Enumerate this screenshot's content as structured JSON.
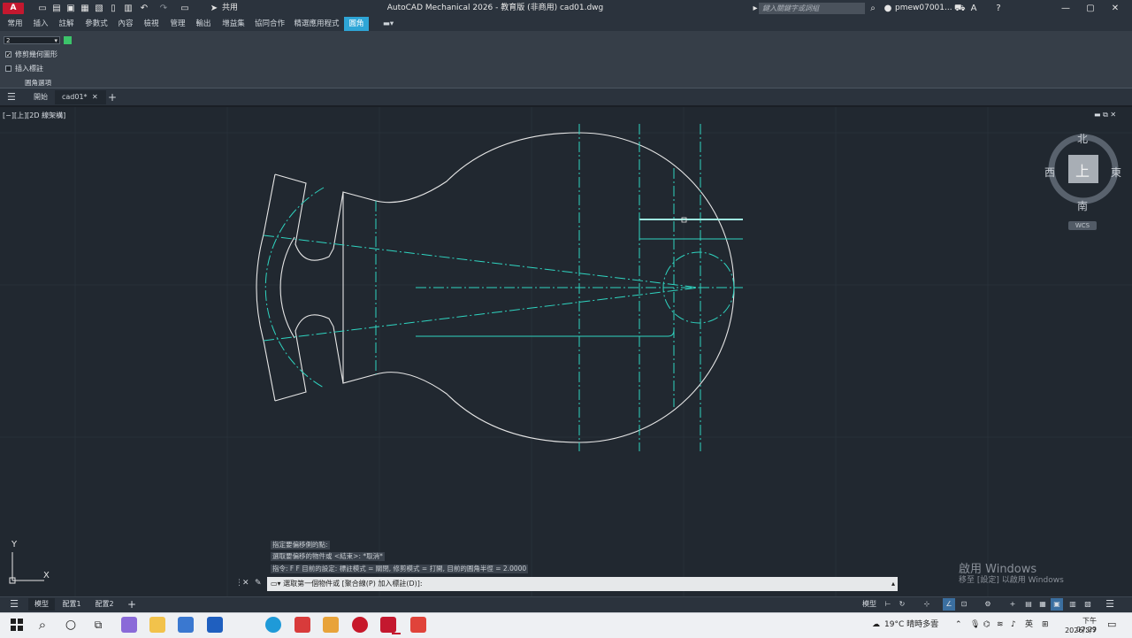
{
  "titlebar": {
    "app_icon": "A",
    "app_icon_sub": "MEC",
    "share_label": "共用",
    "title": "AutoCAD Mechanical 2026 - 教育版 (非商用)    cad01.dwg",
    "search_placeholder": "鍵入關鍵字或詞組",
    "user": "pmew07001...",
    "icons": [
      "new-icon",
      "open-icon",
      "save-icon",
      "saveas-icon",
      "print-icon",
      "undo-icon",
      "redo-icon",
      "share-icon",
      "search-icon",
      "user-icon",
      "cart-icon",
      "help-icon",
      "minimize-icon",
      "maximize-icon",
      "close-icon"
    ]
  },
  "ribbon": {
    "tabs": [
      "常用",
      "插入",
      "註解",
      "參數式",
      "內容",
      "檢視",
      "管理",
      "輸出",
      "增益集",
      "協同合作",
      "精選應用程式",
      "圓角"
    ],
    "active_tab": "圓角",
    "combo_value": "2",
    "checkbox1_label": "修剪幾何圖形",
    "checkbox1_checked": true,
    "checkbox2_label": "插入標註",
    "checkbox2_checked": false,
    "panel_title": "圓角選項"
  },
  "filetabs": {
    "start": "開始",
    "doc": "cad01*"
  },
  "viewport": {
    "label": "[−][上][2D 線架構]",
    "viewcube": {
      "north": "北",
      "south": "南",
      "east": "東",
      "west": "西",
      "top": "上",
      "wcs": "WCS"
    },
    "ucs": {
      "x": "X",
      "y": "Y"
    }
  },
  "command": {
    "history": [
      "指定要偏移側的點:",
      "選取要偏移的物件或 <結束>: *取消*",
      "指令: F F 目前的設定: 標註模式 = 關閉, 修剪模式 = 打開, 目前的圓角半徑 = 2.0000"
    ],
    "prompt": "選取第一個物件或 [聚合線(P) 加入標註(D)]:"
  },
  "statusbar": {
    "tabs": [
      "模型",
      "配置1",
      "配置2"
    ],
    "active": "模型",
    "mode_label": "模型",
    "lang": "英"
  },
  "watermark": {
    "line1": "啟用 Windows",
    "line2": "移至 [設定] 以啟用 Windows"
  },
  "taskbar": {
    "weather": "19°C  晴時多雲",
    "time": "下午 07:29",
    "date": "2026/3/7"
  },
  "colors": {
    "accent": "#2ea5d6",
    "canvas": "#212830",
    "centerline": "#2fd4c0",
    "outline": "#e6e6e6"
  }
}
